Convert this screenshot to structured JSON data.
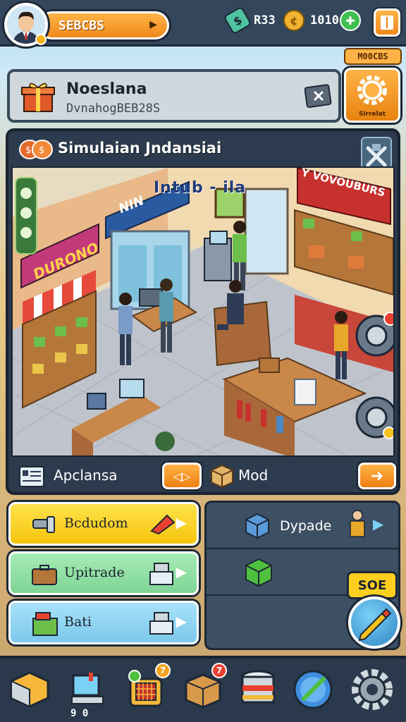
{
  "player": {
    "name": "SEBCBS"
  },
  "resources": [
    {
      "icon": "cash-icon",
      "value": "R33",
      "color": "#4fc3a1"
    },
    {
      "icon": "coins-icon",
      "value": "1010",
      "color": "#f2b233"
    },
    {
      "icon": "gem-icon",
      "value": "",
      "color": "#3fbf4f"
    }
  ],
  "top_badge": "M00CBS",
  "info": {
    "title": "Noeslana",
    "subtitle": "DvnahogBEB28S"
  },
  "settings_label": "Sirrelat",
  "simulation": {
    "title": "Simulaian Jndansiai",
    "scene_sign": "Intub - ila",
    "store_sign_left": "DURONO",
    "store_sign_back": "NIN",
    "store_sign_right": "Y VOVOUBURS",
    "footer_left_label": "Apclansa",
    "footer_mid_label": "Mod"
  },
  "actions": [
    {
      "label": "Bcdudom",
      "color": "#ffd21f"
    },
    {
      "label": "Upitrade",
      "color": "#8fe0a0"
    },
    {
      "label": "Bati",
      "color": "#8fd6f5"
    }
  ],
  "right_panel": {
    "label": "Dypade"
  },
  "sde_badge": "SOE",
  "bottom_nav": {
    "count_label": "9 0",
    "badges": {
      "grid": "7",
      "box": "7"
    }
  }
}
